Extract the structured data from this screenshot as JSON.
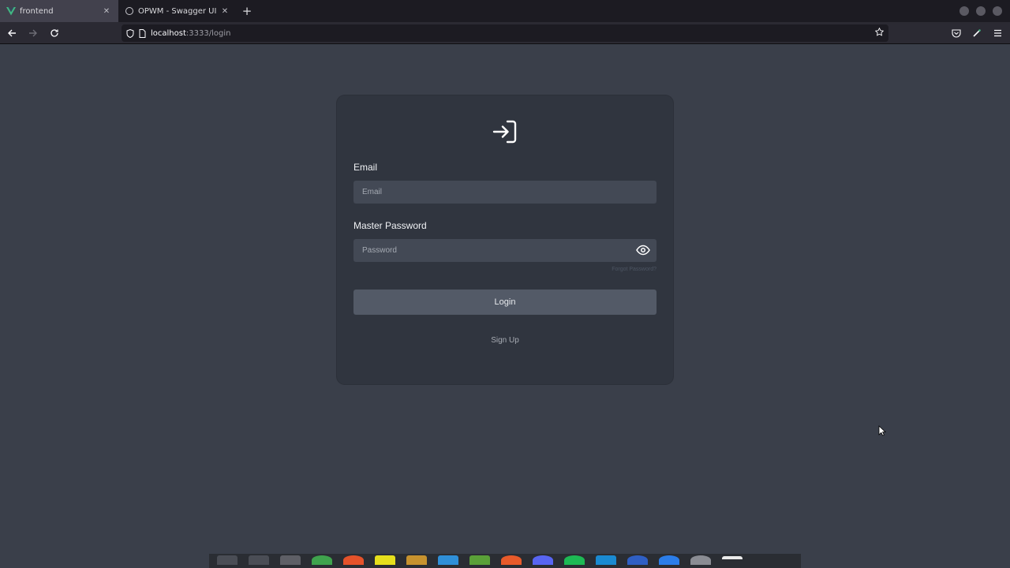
{
  "browser": {
    "tabs": [
      {
        "title": "frontend",
        "active": true
      },
      {
        "title": "OPWM - Swagger UI",
        "active": false
      }
    ],
    "url": {
      "host": "localhost",
      "path": ":3333/login"
    }
  },
  "login": {
    "email_label": "Email",
    "email_placeholder": "Email",
    "password_label": "Master Password",
    "password_placeholder": "Password",
    "forgot_label": "Forgot Password?",
    "login_label": "Login",
    "signup_label": "Sign Up"
  },
  "colors": {
    "page_bg": "#3a3f4a",
    "card_bg": "#30353f",
    "input_bg": "#434955",
    "button_bg": "#535a67",
    "accent_vue": "#41b883"
  },
  "dock": {
    "apps": [
      "app-1-icon",
      "app-2-icon",
      "app-3-icon",
      "app-4-icon",
      "app-5-icon",
      "app-6-icon",
      "app-7-icon",
      "app-8-icon",
      "app-9-icon",
      "app-10-icon",
      "app-11-icon",
      "app-12-icon",
      "app-13-icon",
      "app-14-icon",
      "app-15-icon",
      "app-16-icon",
      "app-17-icon"
    ]
  }
}
